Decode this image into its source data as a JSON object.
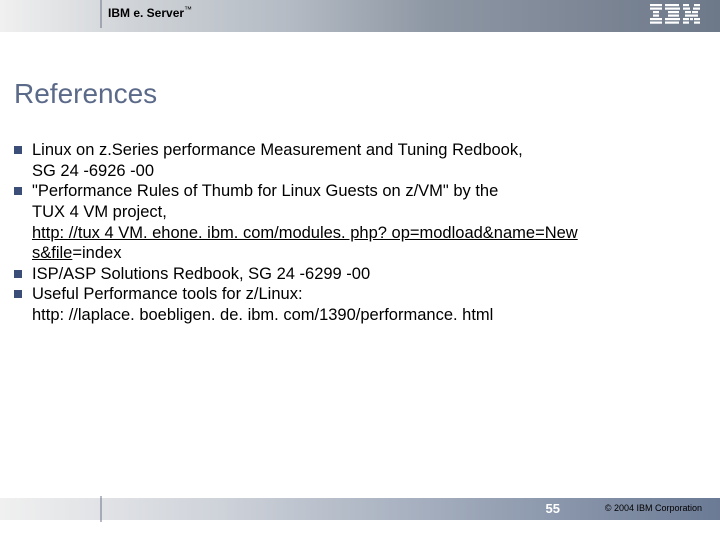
{
  "header": {
    "brand_prefix": "IBM e. Server",
    "tm": "™"
  },
  "title": "References",
  "bullets": {
    "b1_line1": "Linux on z.Series performance Measurement and Tuning Redbook,",
    "b1_line2": "SG 24 -6926 -00",
    "b2_line1": "\"Performance Rules of Thumb for Linux Guests on z/VM\" by the",
    "b2_line2": "TUX 4 VM project,",
    "b2_link1": "http: //tux 4 VM. ehone. ibm. com/modules. php? op=modload&name=New",
    "b2_link2": "s&file",
    "b2_after": "=index",
    "b3": "ISP/ASP Solutions Redbook, SG 24 -6299 -00",
    "b4_line1": "Useful Performance tools for z/Linux:",
    "b4_line2": "http: //laplace. boebligen. de. ibm. com/1390/performance. html"
  },
  "footer": {
    "page": "55",
    "copyright": "© 2004 IBM Corporation"
  }
}
